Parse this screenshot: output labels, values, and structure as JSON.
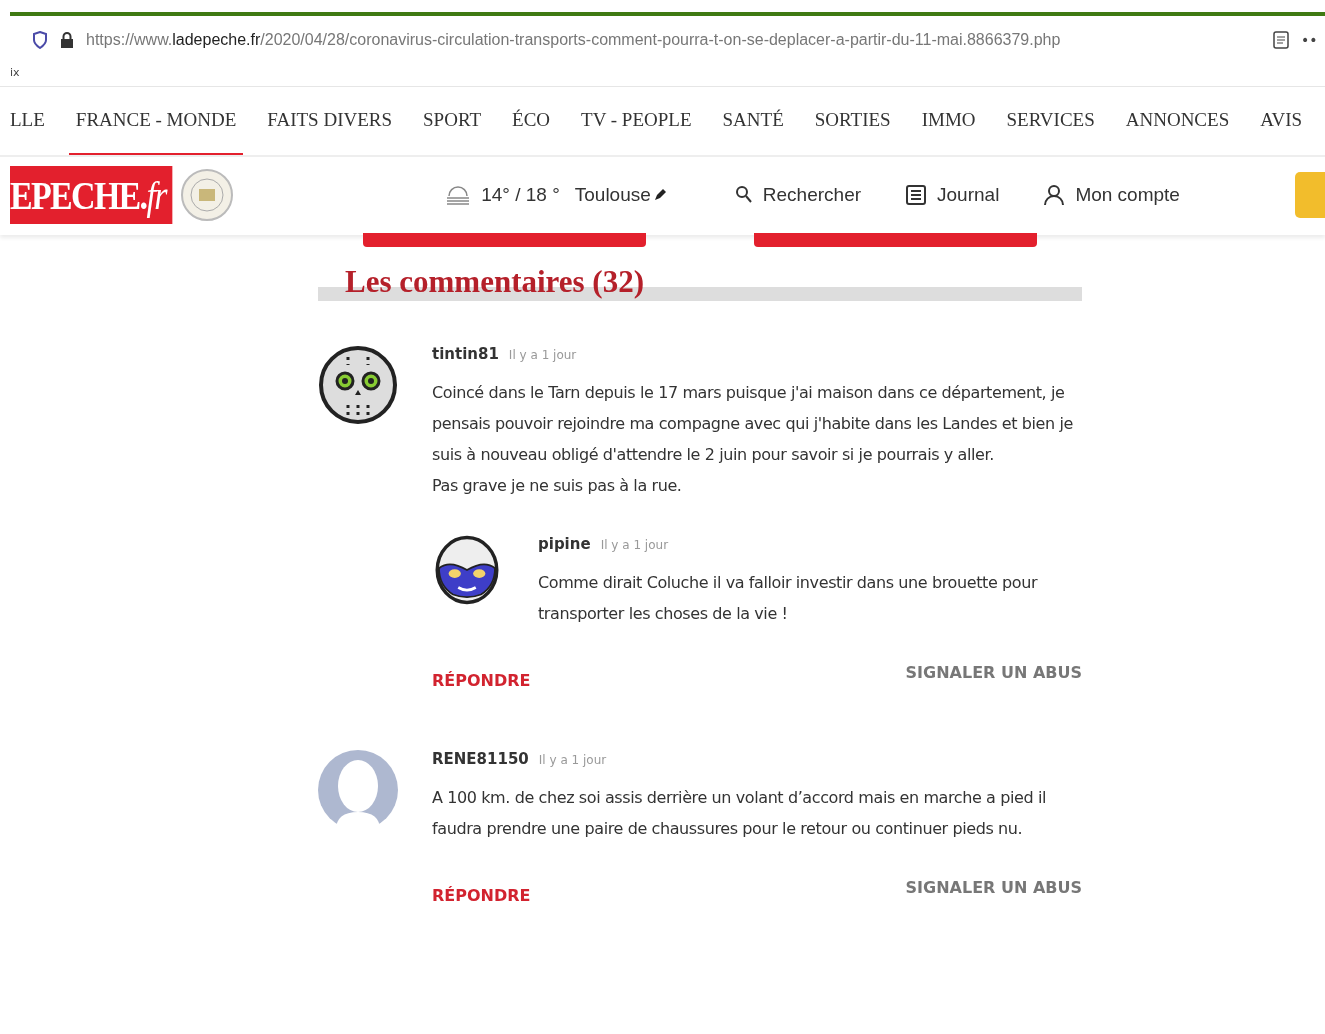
{
  "browser": {
    "url_prefix": "https://www.",
    "url_domain": "ladepeche.fr",
    "url_path": "/2020/04/28/coronavirus-circulation-transports-comment-pourra-t-on-se-deplacer-a-partir-du-11-mai.8866379.php",
    "menu": "••",
    "tab_label": "ix"
  },
  "nav": [
    {
      "label": "LLE",
      "selected": false
    },
    {
      "label": "FRANCE - MONDE",
      "selected": true
    },
    {
      "label": "FAITS DIVERS",
      "selected": false
    },
    {
      "label": "SPORT",
      "selected": false
    },
    {
      "label": "ÉCO",
      "selected": false
    },
    {
      "label": "TV - PEOPLE",
      "selected": false
    },
    {
      "label": "SANTÉ",
      "selected": false
    },
    {
      "label": "SORTIES",
      "selected": false
    },
    {
      "label": "IMMO",
      "selected": false
    },
    {
      "label": "SERVICES",
      "selected": false
    },
    {
      "label": "ANNONCES",
      "selected": false
    },
    {
      "label": "AVIS",
      "selected": false
    }
  ],
  "header": {
    "logo": "EPECHE.*fr*",
    "weather": "14° / 18 °",
    "city": "Toulouse",
    "search": "Rechercher",
    "journal": "Journal",
    "account": "Mon compte"
  },
  "comments_title": "Les commentaires (32)",
  "comments": [
    {
      "author": "tintin81",
      "time": "Il y a 1 jour",
      "kind": "skull",
      "text": "Coincé dans le Tarn depuis le 17 mars puisque j'ai maison dans ce département, je pensais pouvoir rejoindre ma compagne avec qui j'habite dans les Landes et bien je suis à nouveau obligé d'attendre le 2 juin pour savoir si je pourrais y aller.\nPas grave je ne suis pas à la rue.",
      "replies": [
        {
          "author": "pipine",
          "time": "Il y a 1 jour",
          "kind": "mask",
          "text": "Comme dirait Coluche il va falloir investir dans une brouette pour transporter les choses de la vie !"
        }
      ],
      "reply": "RÉPONDRE",
      "report": "SIGNALER UN ABUS"
    },
    {
      "author": "RENE81150",
      "time": "Il y a 1 jour",
      "kind": "default",
      "text": "A 100 km. de chez soi assis derrière un volant d’accord mais en marche a pied il faudra prendre une paire de chaussures pour le retour ou continuer pieds nu.",
      "reply": "RÉPONDRE",
      "report": "SIGNALER UN ABUS"
    }
  ]
}
